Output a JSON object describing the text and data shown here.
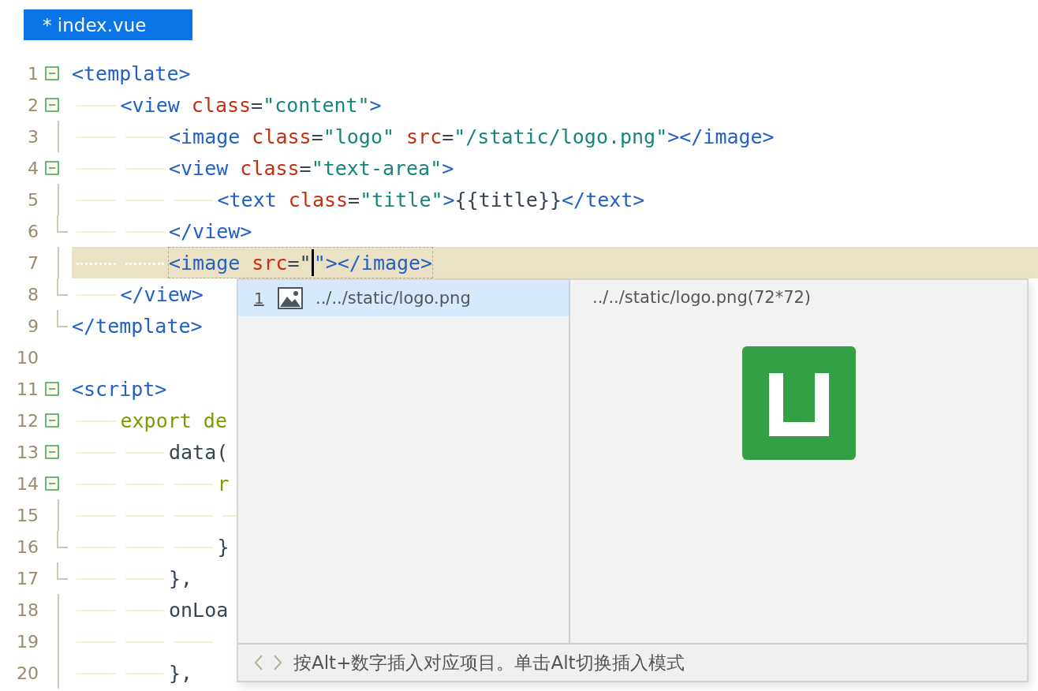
{
  "tab": {
    "title": "* index.vue",
    "selected": true
  },
  "lines": [
    {
      "number": "1",
      "kind": "fold",
      "tokens": [
        {
          "kind": "tag",
          "text": "<template>"
        }
      ],
      "children": [
        {
          "number": "2",
          "kind": "fold",
          "tokens": [
            {
              "kind": "tag",
              "text": "<view "
            },
            {
              "kind": "attr",
              "text": "class"
            },
            {
              "kind": "plain",
              "text": "="
            },
            {
              "kind": "str",
              "text": "\"content\""
            },
            {
              "kind": "tag",
              "text": ">"
            }
          ],
          "children": [
            {
              "number": "3",
              "kind": "guide",
              "tokens": [
                {
                  "kind": "tag",
                  "text": "<image "
                },
                {
                  "kind": "attr",
                  "text": "class"
                },
                {
                  "kind": "plain",
                  "text": "="
                },
                {
                  "kind": "str",
                  "text": "\"logo\" "
                },
                {
                  "kind": "attr",
                  "text": "src"
                },
                {
                  "kind": "plain",
                  "text": "="
                },
                {
                  "kind": "str",
                  "text": "\"/static/logo.png\""
                },
                {
                  "kind": "tag",
                  "text": "></image>"
                }
              ]
            },
            {
              "number": "4",
              "kind": "fold",
              "tokens": [
                {
                  "kind": "tag",
                  "text": "<view "
                },
                {
                  "kind": "attr",
                  "text": "class"
                },
                {
                  "kind": "plain",
                  "text": "="
                },
                {
                  "kind": "str",
                  "text": "\"text-area\""
                },
                {
                  "kind": "tag",
                  "text": ">"
                }
              ],
              "children": [
                {
                  "number": "5",
                  "kind": "guide",
                  "tokens": [
                    {
                      "kind": "tag",
                      "text": "<text "
                    },
                    {
                      "kind": "attr",
                      "text": "class"
                    },
                    {
                      "kind": "plain",
                      "text": "="
                    },
                    {
                      "kind": "str",
                      "text": "\"title\""
                    },
                    {
                      "kind": "tag",
                      "text": ">"
                    },
                    {
                      "kind": "plain",
                      "text": "{{title}}"
                    },
                    {
                      "kind": "tag",
                      "text": "</text>"
                    }
                  ]
                }
              ]
            },
            {
              "number": "6",
              "kind": "end",
              "tokens": [
                {
                  "kind": "tag",
                  "text": "</view>"
                }
              ]
            },
            {
              "number": "7",
              "kind": "guide",
              "current": true,
              "tokens": [
                {
                  "kind": "tag",
                  "text": "<image "
                },
                {
                  "kind": "attr",
                  "text": "src"
                },
                {
                  "kind": "plain",
                  "text": "=\"",
                  "caret": true
                },
                {
                  "kind": "tag",
                  "text": "\"></image>"
                }
              ]
            }
          ]
        },
        {
          "number": "8",
          "kind": "end",
          "tokens": [
            {
              "kind": "tag",
              "text": "</view>"
            }
          ]
        }
      ]
    },
    {
      "number": "9",
      "kind": "end",
      "tokens": [
        {
          "kind": "tag",
          "text": "</template>"
        }
      ]
    },
    {
      "number": "10",
      "kind": "plain"
    },
    {
      "number": "11",
      "kind": "fold",
      "tokens": [
        {
          "kind": "tag",
          "text": "<script>"
        }
      ],
      "children": [
        {
          "number": "12",
          "kind": "fold",
          "tokens": [
            {
              "kind": "kw",
              "text": "export de"
            }
          ],
          "children": [
            {
              "number": "13",
              "kind": "fold",
              "tokens": [
                {
                  "kind": "plain",
                  "text": "data("
                }
              ],
              "children": [
                {
                  "number": "14",
                  "kind": "fold",
                  "tokens": [
                    {
                      "kind": "kw",
                      "text": "r"
                    }
                  ],
                  "children": [
                    {
                      "number": "15",
                      "kind": "guide"
                    }
                  ]
                },
                {
                  "number": "16",
                  "kind": "end",
                  "tokens": [
                    {
                      "kind": "plain",
                      "text": "}"
                    }
                  ]
                }
              ]
            },
            {
              "number": "17",
              "kind": "end",
              "tokens": [
                {
                  "kind": "plain",
                  "text": "},"
                }
              ]
            },
            {
              "number": "18",
              "kind": "guide",
              "tokens": [
                {
                  "kind": "plain",
                  "text": "onLoa"
                }
              ],
              "children": [
                {
                  "number": "19",
                  "kind": "guide"
                }
              ]
            },
            {
              "number": "20",
              "kind": "guide",
              "tokens": [
                {
                  "kind": "plain",
                  "text": "},"
                }
              ]
            }
          ]
        }
      ]
    }
  ],
  "popup": {
    "items": [
      {
        "shortcut": "1",
        "path": "../../static/logo.png",
        "selected": true
      }
    ],
    "preview_title": "../../static/logo.png(72*72)",
    "footer": "按Alt+数字插入对应项目。单击Alt切换插入模式"
  }
}
